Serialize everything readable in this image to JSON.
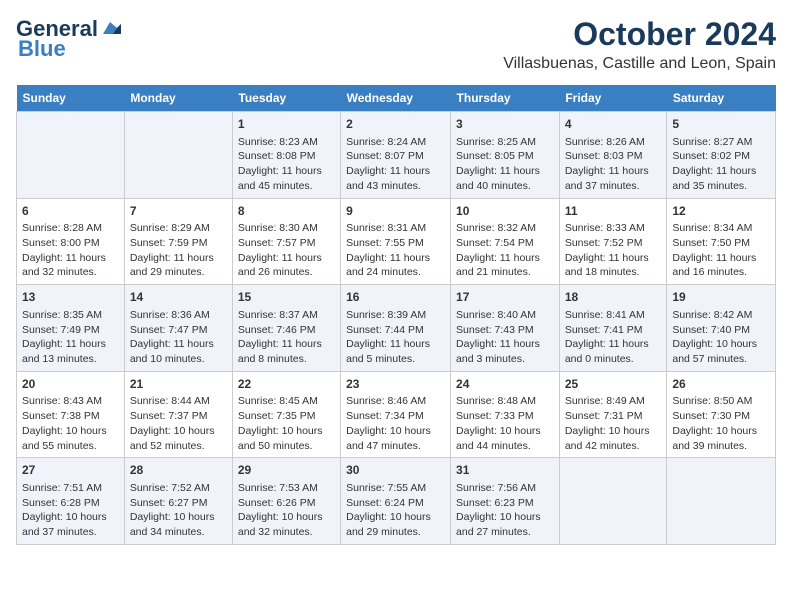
{
  "logo": {
    "general": "General",
    "blue": "Blue"
  },
  "title": "October 2024",
  "location": "Villasbuenas, Castille and Leon, Spain",
  "weekdays": [
    "Sunday",
    "Monday",
    "Tuesday",
    "Wednesday",
    "Thursday",
    "Friday",
    "Saturday"
  ],
  "weeks": [
    [
      {
        "day": "",
        "content": ""
      },
      {
        "day": "",
        "content": ""
      },
      {
        "day": "1",
        "content": "Sunrise: 8:23 AM\nSunset: 8:08 PM\nDaylight: 11 hours and 45 minutes."
      },
      {
        "day": "2",
        "content": "Sunrise: 8:24 AM\nSunset: 8:07 PM\nDaylight: 11 hours and 43 minutes."
      },
      {
        "day": "3",
        "content": "Sunrise: 8:25 AM\nSunset: 8:05 PM\nDaylight: 11 hours and 40 minutes."
      },
      {
        "day": "4",
        "content": "Sunrise: 8:26 AM\nSunset: 8:03 PM\nDaylight: 11 hours and 37 minutes."
      },
      {
        "day": "5",
        "content": "Sunrise: 8:27 AM\nSunset: 8:02 PM\nDaylight: 11 hours and 35 minutes."
      }
    ],
    [
      {
        "day": "6",
        "content": "Sunrise: 8:28 AM\nSunset: 8:00 PM\nDaylight: 11 hours and 32 minutes."
      },
      {
        "day": "7",
        "content": "Sunrise: 8:29 AM\nSunset: 7:59 PM\nDaylight: 11 hours and 29 minutes."
      },
      {
        "day": "8",
        "content": "Sunrise: 8:30 AM\nSunset: 7:57 PM\nDaylight: 11 hours and 26 minutes."
      },
      {
        "day": "9",
        "content": "Sunrise: 8:31 AM\nSunset: 7:55 PM\nDaylight: 11 hours and 24 minutes."
      },
      {
        "day": "10",
        "content": "Sunrise: 8:32 AM\nSunset: 7:54 PM\nDaylight: 11 hours and 21 minutes."
      },
      {
        "day": "11",
        "content": "Sunrise: 8:33 AM\nSunset: 7:52 PM\nDaylight: 11 hours and 18 minutes."
      },
      {
        "day": "12",
        "content": "Sunrise: 8:34 AM\nSunset: 7:50 PM\nDaylight: 11 hours and 16 minutes."
      }
    ],
    [
      {
        "day": "13",
        "content": "Sunrise: 8:35 AM\nSunset: 7:49 PM\nDaylight: 11 hours and 13 minutes."
      },
      {
        "day": "14",
        "content": "Sunrise: 8:36 AM\nSunset: 7:47 PM\nDaylight: 11 hours and 10 minutes."
      },
      {
        "day": "15",
        "content": "Sunrise: 8:37 AM\nSunset: 7:46 PM\nDaylight: 11 hours and 8 minutes."
      },
      {
        "day": "16",
        "content": "Sunrise: 8:39 AM\nSunset: 7:44 PM\nDaylight: 11 hours and 5 minutes."
      },
      {
        "day": "17",
        "content": "Sunrise: 8:40 AM\nSunset: 7:43 PM\nDaylight: 11 hours and 3 minutes."
      },
      {
        "day": "18",
        "content": "Sunrise: 8:41 AM\nSunset: 7:41 PM\nDaylight: 11 hours and 0 minutes."
      },
      {
        "day": "19",
        "content": "Sunrise: 8:42 AM\nSunset: 7:40 PM\nDaylight: 10 hours and 57 minutes."
      }
    ],
    [
      {
        "day": "20",
        "content": "Sunrise: 8:43 AM\nSunset: 7:38 PM\nDaylight: 10 hours and 55 minutes."
      },
      {
        "day": "21",
        "content": "Sunrise: 8:44 AM\nSunset: 7:37 PM\nDaylight: 10 hours and 52 minutes."
      },
      {
        "day": "22",
        "content": "Sunrise: 8:45 AM\nSunset: 7:35 PM\nDaylight: 10 hours and 50 minutes."
      },
      {
        "day": "23",
        "content": "Sunrise: 8:46 AM\nSunset: 7:34 PM\nDaylight: 10 hours and 47 minutes."
      },
      {
        "day": "24",
        "content": "Sunrise: 8:48 AM\nSunset: 7:33 PM\nDaylight: 10 hours and 44 minutes."
      },
      {
        "day": "25",
        "content": "Sunrise: 8:49 AM\nSunset: 7:31 PM\nDaylight: 10 hours and 42 minutes."
      },
      {
        "day": "26",
        "content": "Sunrise: 8:50 AM\nSunset: 7:30 PM\nDaylight: 10 hours and 39 minutes."
      }
    ],
    [
      {
        "day": "27",
        "content": "Sunrise: 7:51 AM\nSunset: 6:28 PM\nDaylight: 10 hours and 37 minutes."
      },
      {
        "day": "28",
        "content": "Sunrise: 7:52 AM\nSunset: 6:27 PM\nDaylight: 10 hours and 34 minutes."
      },
      {
        "day": "29",
        "content": "Sunrise: 7:53 AM\nSunset: 6:26 PM\nDaylight: 10 hours and 32 minutes."
      },
      {
        "day": "30",
        "content": "Sunrise: 7:55 AM\nSunset: 6:24 PM\nDaylight: 10 hours and 29 minutes."
      },
      {
        "day": "31",
        "content": "Sunrise: 7:56 AM\nSunset: 6:23 PM\nDaylight: 10 hours and 27 minutes."
      },
      {
        "day": "",
        "content": ""
      },
      {
        "day": "",
        "content": ""
      }
    ]
  ]
}
